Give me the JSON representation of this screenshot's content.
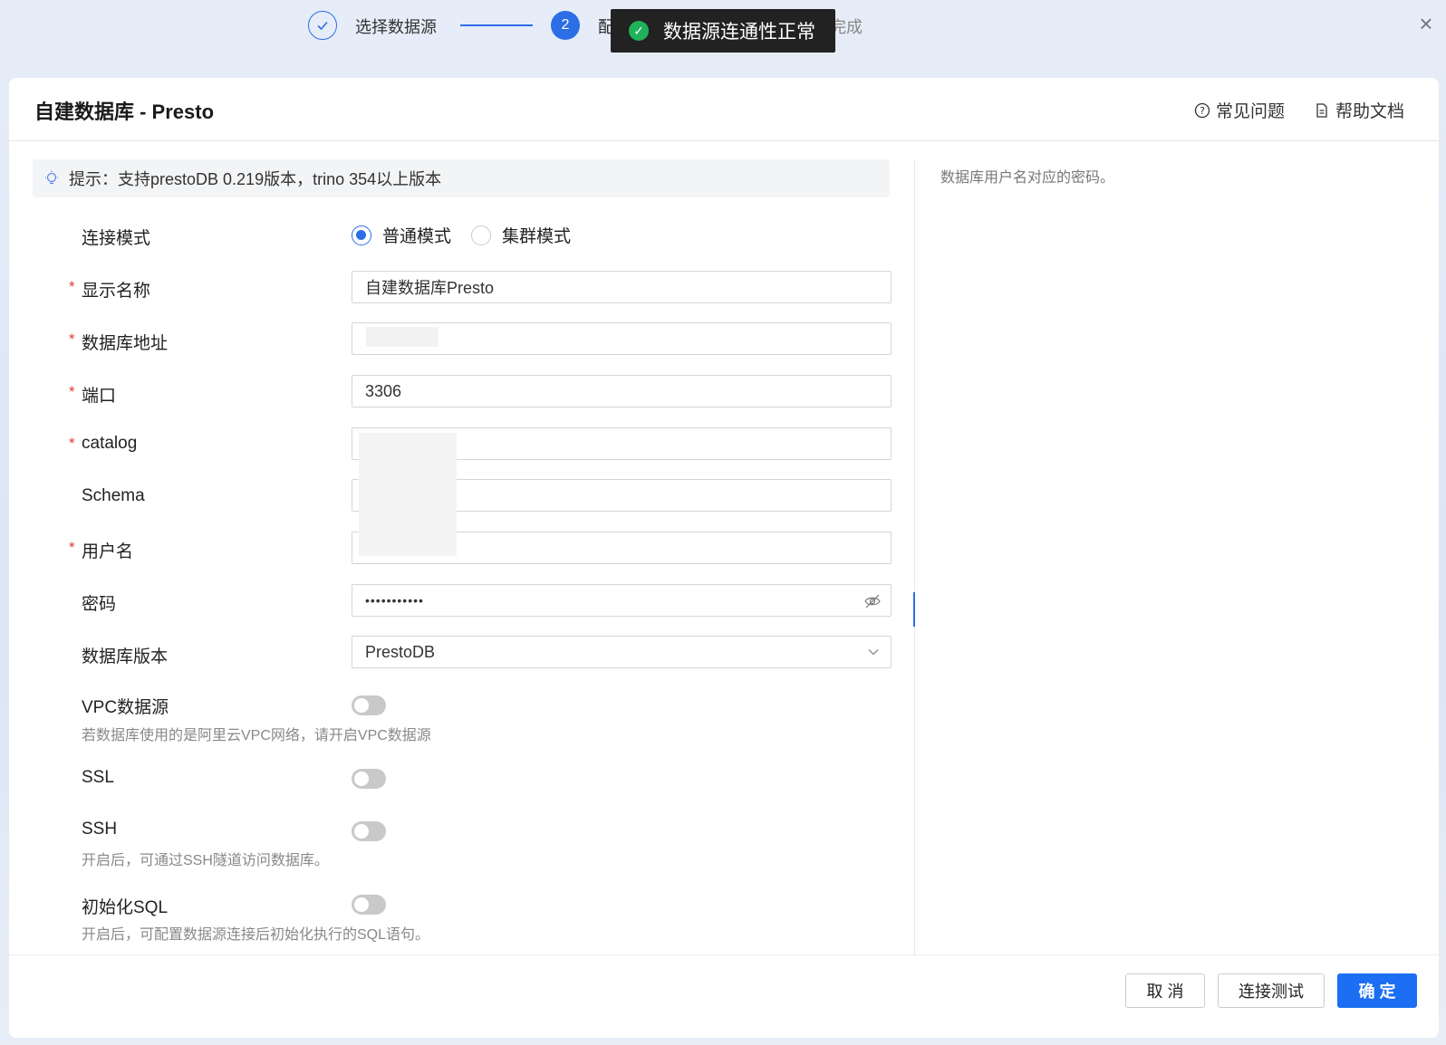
{
  "stepper": {
    "step1_label": "选择数据源",
    "step2_number": "2",
    "step2_label": "配",
    "step3_label": "完成"
  },
  "toast": {
    "message": "数据源连通性正常"
  },
  "header": {
    "title": "自建数据库 - Presto",
    "faq": "常见问题",
    "help": "帮助文档"
  },
  "tip": {
    "text": "提示：支持prestoDB 0.219版本，trino 354以上版本"
  },
  "side_help": "数据库用户名对应的密码。",
  "form": {
    "connection_mode": {
      "label": "连接模式",
      "options": [
        "普通模式",
        "集群模式"
      ],
      "selected": "普通模式"
    },
    "display_name": {
      "label": "显示名称",
      "value": "自建数据库Presto"
    },
    "db_address": {
      "label": "数据库地址",
      "value": ""
    },
    "port": {
      "label": "端口",
      "value": "3306"
    },
    "catalog": {
      "label": "catalog",
      "value": ""
    },
    "schema": {
      "label": "Schema",
      "value": ""
    },
    "username": {
      "label": "用户名",
      "value": ""
    },
    "password": {
      "label": "密码",
      "value": "•••••••••••"
    },
    "db_version": {
      "label": "数据库版本",
      "value": "PrestoDB"
    },
    "vpc": {
      "label": "VPC数据源",
      "hint": "若数据库使用的是阿里云VPC网络，请开启VPC数据源",
      "on": false
    },
    "ssl": {
      "label": "SSL",
      "on": false
    },
    "ssh": {
      "label": "SSH",
      "hint": "开启后，可通过SSH隧道访问数据库。",
      "on": false
    },
    "init_sql": {
      "label": "初始化SQL",
      "hint": "开启后，可配置数据源连接后初始化执行的SQL语句。",
      "on": false
    }
  },
  "footer": {
    "cancel": "取 消",
    "test": "连接测试",
    "ok": "确 定"
  },
  "colors": {
    "primary": "#1c6ef2",
    "success": "#1fb25a",
    "required": "#e53935"
  }
}
